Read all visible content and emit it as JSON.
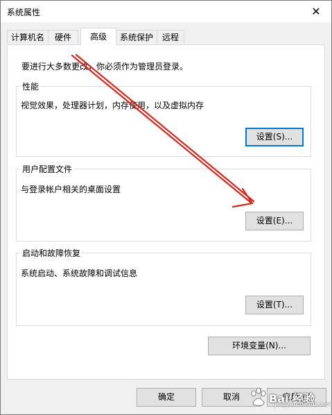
{
  "window": {
    "title": "系统属性",
    "close_glyph": "✕"
  },
  "tabs": [
    {
      "label": "计算机名"
    },
    {
      "label": "硬件"
    },
    {
      "label": "高级",
      "active": true
    },
    {
      "label": "系统保护"
    },
    {
      "label": "远程"
    }
  ],
  "advanced": {
    "notice": "要进行大多数更改，你必须作为管理员登录。",
    "performance": {
      "title": "性能",
      "desc": "视觉效果，处理器计划，内存使用，以及虚拟内存",
      "button": "设置(S)..."
    },
    "profile": {
      "title": "用户配置文件",
      "desc": "与登录帐户相关的桌面设置",
      "button": "设置(E)..."
    },
    "startup": {
      "title": "启动和故障恢复",
      "desc": "系统启动、系统故障和调试信息",
      "button": "设置(T)..."
    },
    "env_button": "环境变量(N)..."
  },
  "footer": {
    "ok": "确定",
    "cancel": "取消",
    "apply": "应用(A)"
  },
  "watermark": {
    "text": "Bai 经验",
    "sub": "jingyan.baidu.com"
  },
  "colors": {
    "annotation_arrow": "#d9241c",
    "focus_border": "#0078d7"
  }
}
